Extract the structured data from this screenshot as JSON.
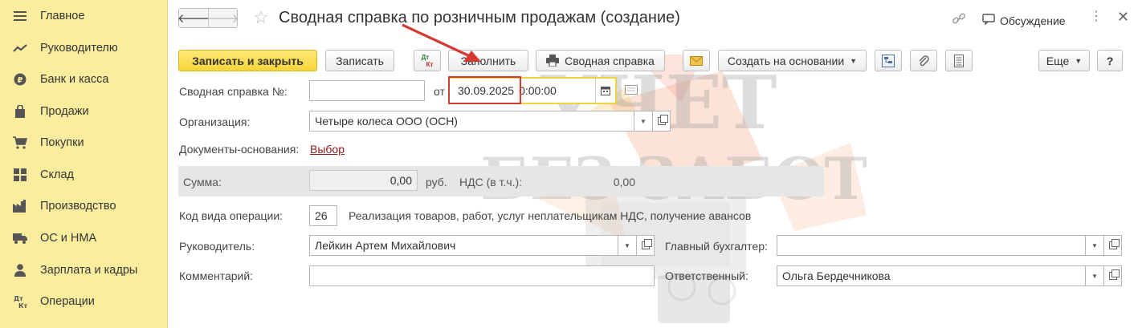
{
  "sidebar": {
    "items": [
      {
        "label": "Главное",
        "icon": "menu-icon"
      },
      {
        "label": "Руководителю",
        "icon": "trend-icon"
      },
      {
        "label": "Банк и касса",
        "icon": "coin-icon"
      },
      {
        "label": "Продажи",
        "icon": "bag-icon"
      },
      {
        "label": "Покупки",
        "icon": "cart-icon"
      },
      {
        "label": "Склад",
        "icon": "grid-icon"
      },
      {
        "label": "Производство",
        "icon": "factory-icon"
      },
      {
        "label": "ОС и НМА",
        "icon": "truck-icon"
      },
      {
        "label": "Зарплата и кадры",
        "icon": "person-icon"
      },
      {
        "label": "Операции",
        "icon": "dt-kt-icon"
      }
    ]
  },
  "header": {
    "title": "Сводная справка по розничным продажам (создание)",
    "discussion_label": "Обсуждение"
  },
  "toolbar": {
    "save_close": "Записать и закрыть",
    "save": "Записать",
    "dt_kt_top": "Дт",
    "dt_kt_bottom": "Кт",
    "fill": "Заполнить",
    "print_summary": "Сводная справка",
    "create_based": "Создать на основании",
    "more": "Еще",
    "help": "?"
  },
  "form": {
    "number_label": "Сводная справка №:",
    "number_value": "",
    "from_label": "от",
    "date_value": "30.09.2025",
    "time_value": "0:00:00",
    "org_label": "Организация:",
    "org_value": "Четыре колеса ООО (ОСН)",
    "base_docs_label": "Документы-основания:",
    "base_docs_link": "Выбор",
    "sum_label": "Сумма:",
    "sum_value": "0,00",
    "currency": "руб.",
    "vat_label": "НДС (в т.ч.):",
    "vat_value": "0,00",
    "op_code_label": "Код вида операции:",
    "op_code_value": "26",
    "op_code_desc": "Реализация товаров, работ, услуг неплательщикам НДС, получение авансов",
    "head_label": "Руководитель:",
    "head_value": "Лейкин Артем Михайлович",
    "chief_acc_label": "Главный бухгалтер:",
    "chief_acc_value": "",
    "comment_label": "Комментарий:",
    "comment_value": "",
    "responsible_label": "Ответственный:",
    "responsible_value": "Ольга Бердечникова"
  },
  "watermark": {
    "line1": "УЧЕТ",
    "line2": "БЕЗ ЗАБОТ"
  },
  "colors": {
    "sidebar_bg": "#fbed9e",
    "primary_button": "#f6d53a",
    "highlight_red": "#d23a32",
    "link": "#8b1a1a"
  }
}
